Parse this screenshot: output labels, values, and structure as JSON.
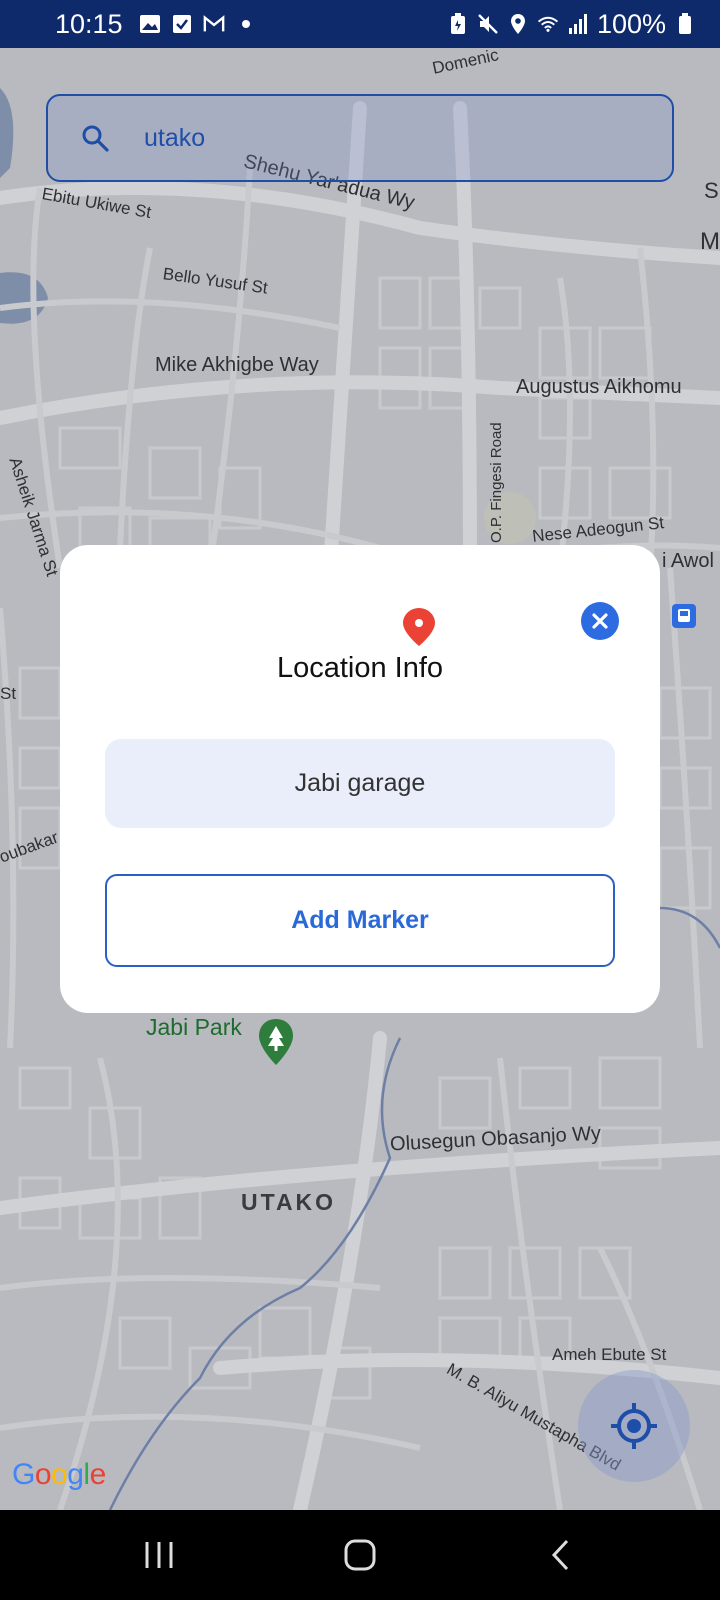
{
  "status_bar": {
    "time": "10:15",
    "battery": "100%",
    "left_icons": [
      "image-icon",
      "check-box-icon",
      "gmail-icon",
      "dot-icon"
    ],
    "right_icons": [
      "battery-saver-icon",
      "mute-icon",
      "location-icon",
      "wifi-icon",
      "signal-icon",
      "battery-icon"
    ]
  },
  "search": {
    "value": "utako"
  },
  "map": {
    "labels": {
      "domenic": "Domenic",
      "shehu": "Shehu Yar'adua Wy",
      "ebitu": "Ebitu Ukiwe St",
      "bello": "Bello Yusuf St",
      "mike": "Mike Akhigbe Way",
      "augustus": "Augustus Aikhomu",
      "ashiek": "Asheik Jarma St",
      "fingesi": "O.P. Fingesi Road",
      "adeogun": "Nese Adeogun St",
      "awol": "i Awol",
      "st_left": "St",
      "oubakar": "oubakar",
      "jabi_park": "Jabi Park",
      "olusegun": "Olusegun Obasanjo Wy",
      "utako": "UTAKO",
      "ameh": "Ameh Ebute St",
      "aliyu": "M. B. Aliyu Mustapha Blvd",
      "edge_m": "M",
      "edge_s": "S"
    },
    "logo": "Google"
  },
  "dialog": {
    "title": "Location Info",
    "location_name": "Jabi garage",
    "add_marker_label": "Add Marker"
  },
  "colors": {
    "accent": "#2d6be0",
    "status_bar": "#0e2a6b",
    "pin": "#ea4335"
  }
}
